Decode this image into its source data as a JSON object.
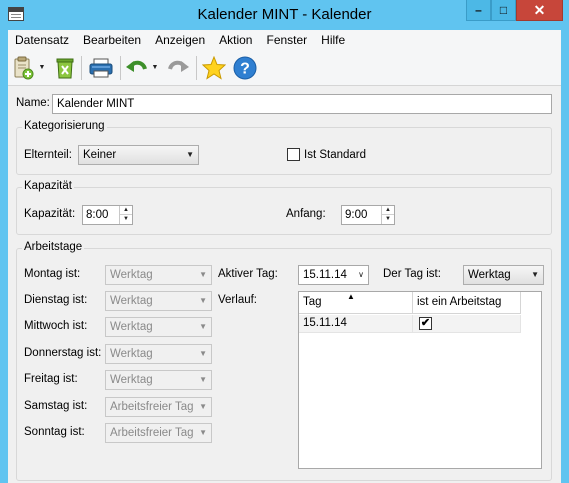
{
  "window": {
    "title": "Kalender MINT - Kalender",
    "controls": {
      "minimize": "–",
      "maximize": "□",
      "close": "✕"
    }
  },
  "menu": [
    "Datensatz",
    "Bearbeiten",
    "Anzeigen",
    "Aktion",
    "Fenster",
    "Hilfe"
  ],
  "toolbar": {
    "icons": [
      "new-record-icon",
      "delete-icon",
      "print-icon",
      "undo-icon",
      "redo-icon",
      "favorite-star-icon",
      "help-icon"
    ]
  },
  "form": {
    "name_label": "Name:",
    "name_value": "Kalender MINT",
    "kategorisierung": {
      "legend": "Kategorisierung",
      "elternteil_label": "Elternteil:",
      "elternteil_value": "Keiner",
      "ist_standard_label": "Ist Standard",
      "ist_standard_checked": false
    },
    "kapazitaet": {
      "legend": "Kapazität",
      "kapazitaet_label": "Kapazität:",
      "kapazitaet_value": "8:00",
      "anfang_label": "Anfang:",
      "anfang_value": "9:00"
    },
    "arbeitstage": {
      "legend": "Arbeitstage",
      "days": [
        {
          "label": "Montag ist:",
          "value": "Werktag"
        },
        {
          "label": "Dienstag ist:",
          "value": "Werktag"
        },
        {
          "label": "Mittwoch ist:",
          "value": "Werktag"
        },
        {
          "label": "Donnerstag ist:",
          "value": "Werktag"
        },
        {
          "label": "Freitag ist:",
          "value": "Werktag"
        },
        {
          "label": "Samstag ist:",
          "value": "Arbeitsfreier Tag"
        },
        {
          "label": "Sonntag ist:",
          "value": "Arbeitsfreier Tag"
        }
      ],
      "aktiver_tag_label": "Aktiver Tag:",
      "aktiver_tag_value": "15.11.14",
      "der_tag_ist_label": "Der Tag ist:",
      "der_tag_ist_value": "Werktag",
      "verlauf_label": "Verlauf:",
      "verlauf_table": {
        "columns": [
          "Tag",
          "ist ein Arbeitstag"
        ],
        "rows": [
          {
            "tag": "15.11.14",
            "ist_arbeitstag": true
          }
        ]
      }
    }
  }
}
